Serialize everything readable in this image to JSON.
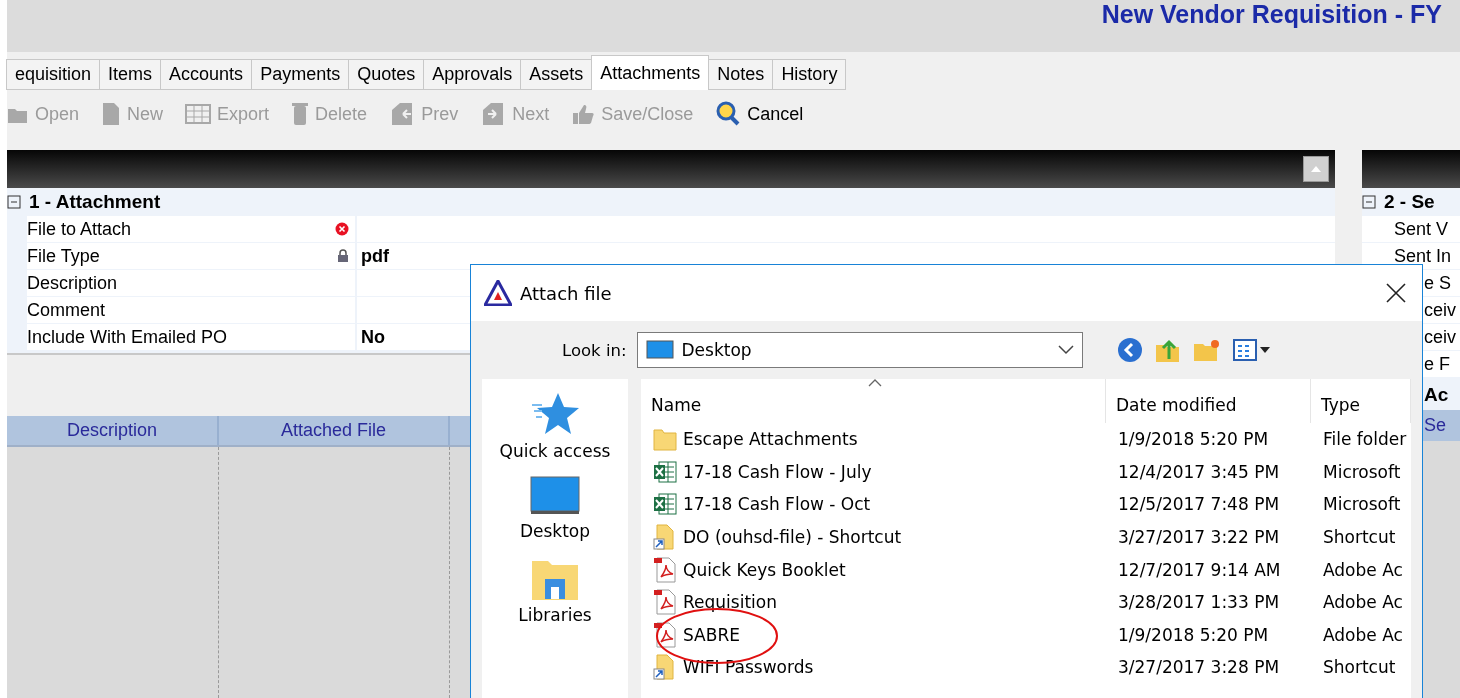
{
  "header": {
    "title": "New Vendor Requisition - FY"
  },
  "tabs": [
    {
      "label": "equisition",
      "selected": false
    },
    {
      "label": "Items",
      "selected": false
    },
    {
      "label": "Accounts",
      "selected": false
    },
    {
      "label": "Payments",
      "selected": false
    },
    {
      "label": "Quotes",
      "selected": false
    },
    {
      "label": "Approvals",
      "selected": false
    },
    {
      "label": "Assets",
      "selected": false
    },
    {
      "label": "Attachments",
      "selected": true
    },
    {
      "label": "Notes",
      "selected": false
    },
    {
      "label": "History",
      "selected": false
    }
  ],
  "toolbar": [
    {
      "label": "Open",
      "kind": "open",
      "disabled": true
    },
    {
      "label": "New",
      "kind": "new",
      "disabled": true
    },
    {
      "label": "Export",
      "kind": "export",
      "disabled": true
    },
    {
      "label": "Delete",
      "kind": "delete",
      "disabled": true
    },
    {
      "label": "Prev",
      "kind": "prev",
      "disabled": true
    },
    {
      "label": "Next",
      "kind": "next",
      "disabled": true
    },
    {
      "label": "Save/Close",
      "kind": "save",
      "disabled": true
    },
    {
      "label": "Cancel",
      "kind": "cancel",
      "disabled": false
    }
  ],
  "attachment_section": {
    "title": "1 - Attachment",
    "expanded": true,
    "fields": [
      {
        "label": "File to Attach",
        "kind": "error"
      },
      {
        "label": "File Type",
        "kind": "locked",
        "value": "pdf"
      },
      {
        "label": "Description",
        "kind": "plain"
      },
      {
        "label": "Comment",
        "kind": "plain"
      },
      {
        "label": "Include With Emailed PO",
        "kind": "plain",
        "value": "No"
      }
    ]
  },
  "grid": {
    "columns": [
      "Description",
      "Attached File"
    ]
  },
  "right_section": {
    "title": "2 - Se",
    "expanded": true,
    "rows": [
      "Sent V",
      "Sent In",
      "e S",
      "ceiv",
      "ceiv",
      "e F"
    ],
    "subheader": "Ac",
    "grid_columns": [
      "Se"
    ]
  },
  "dialog": {
    "title": "Attach file",
    "look_in": {
      "label": "Look in:",
      "value": "Desktop"
    },
    "places": [
      {
        "label": "Quick access",
        "kind": "star"
      },
      {
        "label": "Desktop",
        "kind": "desktop"
      },
      {
        "label": "Libraries",
        "kind": "libraries"
      }
    ],
    "columns": [
      "Name",
      "Date modified",
      "Type"
    ],
    "files": [
      {
        "name": "Escape Attachments",
        "kind": "folder",
        "date": "1/9/2018 5:20 PM",
        "type": "File folder",
        "circled": false
      },
      {
        "name": "17-18 Cash Flow - July",
        "kind": "excel",
        "date": "12/4/2017 3:45 PM",
        "type": "Microsoft",
        "circled": false
      },
      {
        "name": "17-18 Cash Flow - Oct",
        "kind": "excel",
        "date": "12/5/2017 7:48 PM",
        "type": "Microsoft",
        "circled": false
      },
      {
        "name": "DO (ouhsd-file) - Shortcut",
        "kind": "shortcut",
        "date": "3/27/2017 3:22 PM",
        "type": "Shortcut",
        "circled": false
      },
      {
        "name": "Quick Keys Booklet",
        "kind": "pdf",
        "date": "12/7/2017 9:14 AM",
        "type": "Adobe Ac",
        "circled": false
      },
      {
        "name": "Requisition",
        "kind": "pdf",
        "date": "3/28/2017 1:33 PM",
        "type": "Adobe Ac",
        "circled": false
      },
      {
        "name": "SABRE",
        "kind": "pdf",
        "date": "1/9/2018 5:20 PM",
        "type": "Adobe Ac",
        "circled": true
      },
      {
        "name": "WIFI Passwords",
        "kind": "shortcut",
        "date": "3/27/2017 3:28 PM",
        "type": "Shortcut",
        "circled": false
      }
    ]
  }
}
